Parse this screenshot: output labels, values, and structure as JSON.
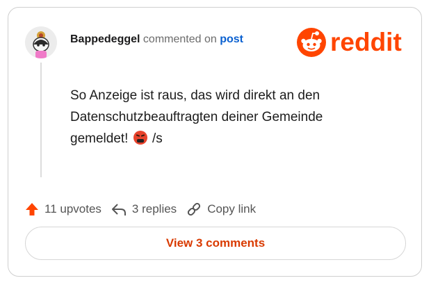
{
  "comment": {
    "username": "Bappedeggel",
    "verb": "commented on",
    "post_link": "post",
    "text_before_emoji": "So Anzeige ist raus, das wird direkt an den Datenschutzbeauftragten deiner Gemeinde gemeldet! ",
    "text_after_emoji": " /s"
  },
  "brand": {
    "name": "reddit",
    "color": "#ff4500"
  },
  "actions": {
    "upvotes": "11 upvotes",
    "replies": "3 replies",
    "copy_link": "Copy link"
  },
  "footer": {
    "view_comments": "View 3 comments"
  },
  "icons": {
    "avatar": "avatar-icon",
    "logo": "reddit-snoo-icon",
    "upvote": "upvote-arrow-icon",
    "reply": "reply-arrow-icon",
    "link": "link-icon",
    "emoji": "angry-face-emoji"
  }
}
